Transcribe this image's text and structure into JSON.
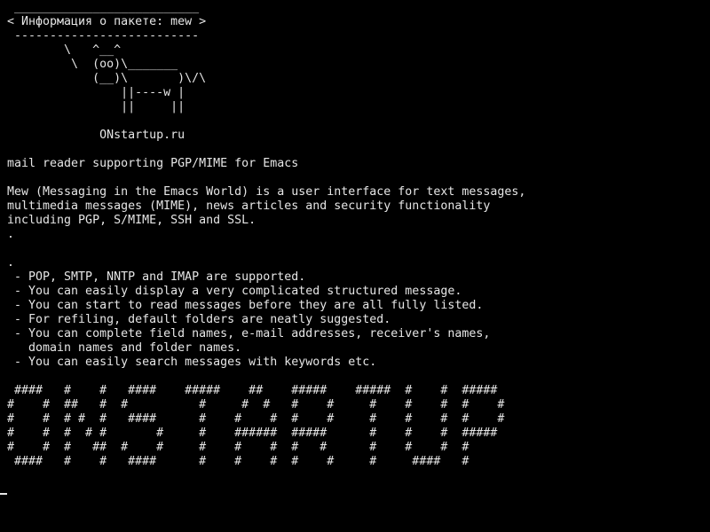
{
  "colors": {
    "background": "#000000",
    "foreground": "#e6e6e6"
  },
  "bubble": [
    " __________________________",
    "< Информация о пакете: mew >",
    " --------------------------",
    "        \\   ^__^",
    "         \\  (oo)\\_______",
    "            (__)\\       )\\/\\",
    "                ||----w |",
    "                ||     ||",
    "",
    "             ONstartup.ru"
  ],
  "summary": "mail reader supporting PGP/MIME for Emacs",
  "description": [
    "Mew (Messaging in the Emacs World) is a user interface for text messages,",
    "multimedia messages (MIME), news articles and security functionality",
    "including PGP, S/MIME, SSH and SSL.",
    "."
  ],
  "features": [
    ".",
    " - POP, SMTP, NNTP and IMAP are supported.",
    " - You can easily display a very complicated structured message.",
    " - You can start to read messages before they are all fully listed.",
    " - For refiling, default folders are neatly suggested.",
    " - You can complete field names, e-mail addresses, receiver's names,",
    "   domain names and folder names.",
    " - You can easily search messages with keywords etc."
  ],
  "banner": [
    " ####   #    #   ####    #####    ##    #####    #####  #    #  #####",
    "#    #  ##   #  #          #     #  #   #    #     #    #    #  #    #",
    "#    #  # #  #   ####      #    #    #  #    #     #    #    #  #    #",
    "#    #  #  # #       #     #    ######  #####      #    #    #  #####",
    "#    #  #   ##  #    #     #    #    #  #   #      #    #    #  #",
    " ####   #    #   ####      #    #    #  #    #     #     ####   #"
  ]
}
